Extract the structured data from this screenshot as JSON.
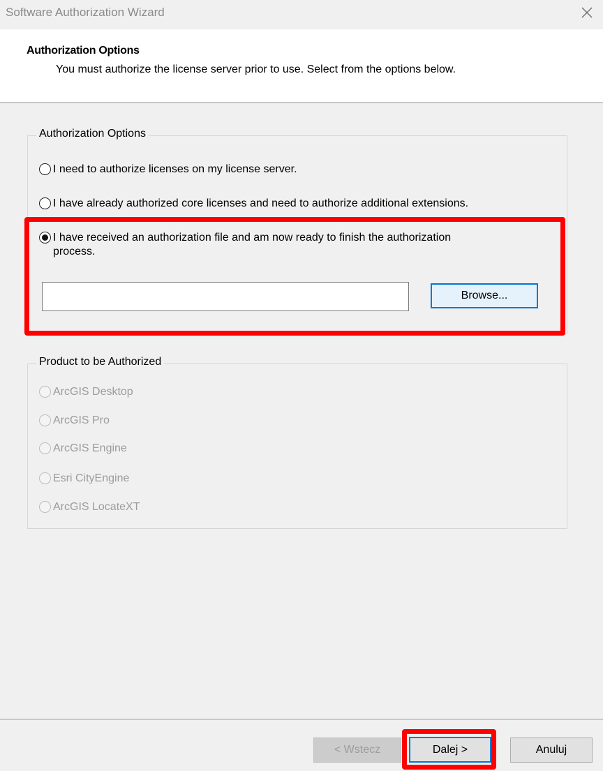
{
  "window": {
    "title": "Software Authorization Wizard",
    "close_icon": "close-icon"
  },
  "header": {
    "title": "Authorization Options",
    "subtitle": "You must authorize the license server prior to use. Select from the options below."
  },
  "auth_options": {
    "legend": "Authorization Options",
    "options": [
      {
        "label": "I need to authorize licenses on my license server.",
        "checked": false
      },
      {
        "label": "I have already authorized core licenses and need to authorize additional extensions.",
        "checked": false
      },
      {
        "label_line1": "I have received an authorization file and am now ready to finish the authorization",
        "label_line2": "process.",
        "checked": true
      }
    ],
    "file_path_value": "",
    "browse_label": "Browse..."
  },
  "product": {
    "legend": "Product to be Authorized",
    "items": [
      "ArcGIS Desktop",
      "ArcGIS Pro",
      "ArcGIS Engine",
      "Esri CityEngine",
      "ArcGIS LocateXT"
    ],
    "enabled": false
  },
  "footer": {
    "back_label": "< Wstecz",
    "next_label": "Dalej >",
    "cancel_label": "Anuluj"
  },
  "colors": {
    "highlight": "#ff0000",
    "focus": "#0078d7",
    "background": "#f0f0f0"
  }
}
